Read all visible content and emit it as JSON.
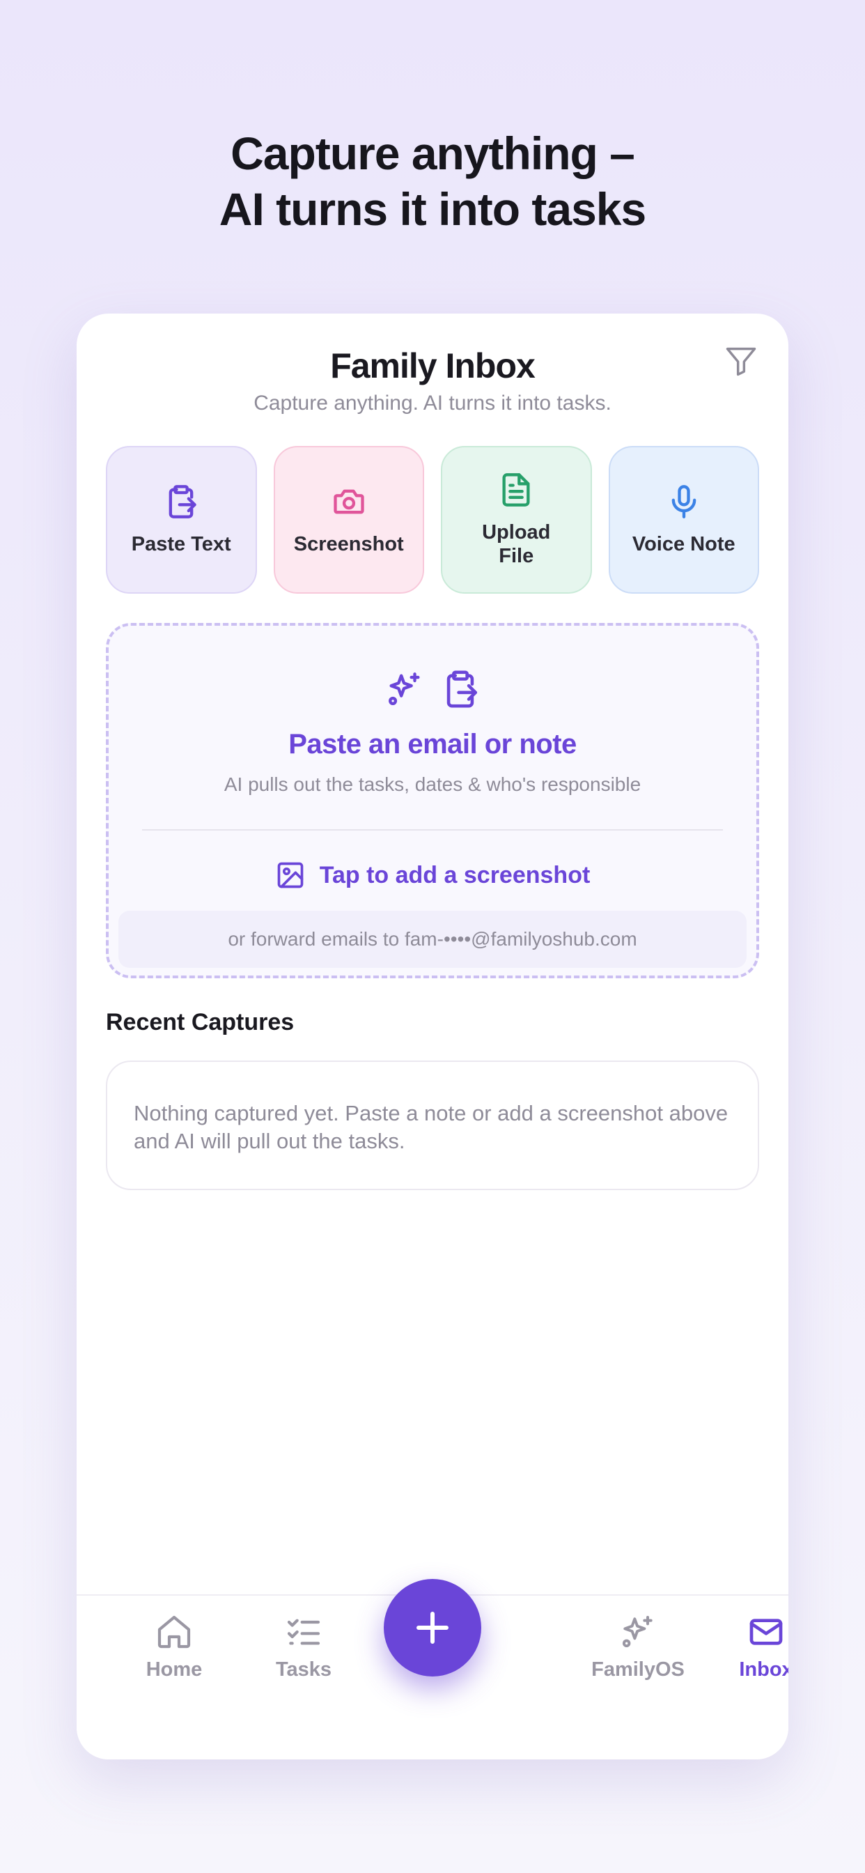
{
  "hero": {
    "line1": "Capture anything –",
    "line2": "AI turns it into tasks"
  },
  "inbox": {
    "title": "Family Inbox",
    "subtitle": "Capture anything. AI turns it into tasks.",
    "filter_icon": "filter-icon"
  },
  "actions": [
    {
      "label": "Paste Text",
      "icon": "clipboard-paste-icon",
      "color": "#6a45d8"
    },
    {
      "label": "Screenshot",
      "icon": "camera-icon",
      "color": "#e0559a"
    },
    {
      "label": "Upload File",
      "icon": "file-text-icon",
      "color": "#27a06a"
    },
    {
      "label": "Voice Note",
      "icon": "microphone-icon",
      "color": "#3b82e6"
    }
  ],
  "dropzone": {
    "title": "Paste an email or note",
    "subtitle": "AI pulls out the tasks, dates & who's responsible",
    "screenshot_label": "Tap to add a screenshot",
    "forward_text": "or forward emails to fam-••••@familyoshub.com"
  },
  "recent": {
    "title": "Recent Captures",
    "empty_text": "Nothing captured yet. Paste a note or add a screenshot above and AI will pull out the tasks."
  },
  "tabs": [
    {
      "label": "Home",
      "icon": "home-icon",
      "active": false
    },
    {
      "label": "Tasks",
      "icon": "checklist-icon",
      "active": false
    },
    {
      "label": "FamilyOS",
      "icon": "sparkles-icon",
      "active": false
    },
    {
      "label": "Inbox",
      "icon": "mail-icon",
      "active": true
    }
  ],
  "fab": {
    "icon": "plus-icon"
  },
  "colors": {
    "accent": "#6a45d8",
    "muted": "#8e8b98",
    "background": "#ebe6fb"
  }
}
